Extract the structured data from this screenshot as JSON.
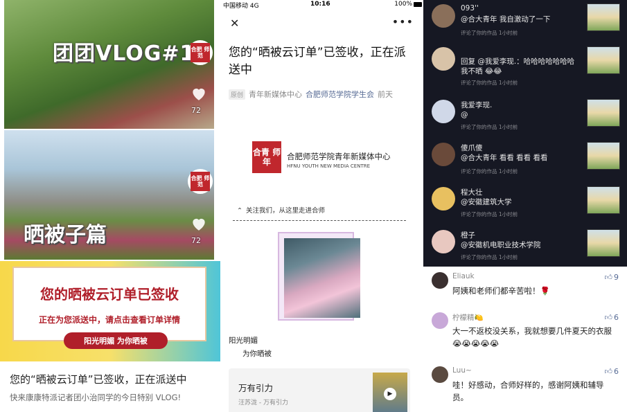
{
  "left_feed": {
    "videos": [
      {
        "title": "团团VLOG#1",
        "logo": "合肥 师范",
        "likes": "72"
      },
      {
        "title": "晒被子篇",
        "logo": "合肥 师范",
        "likes": "72"
      }
    ],
    "banner": {
      "headline": "您的晒被云订单已签收",
      "subline": "正在为您派送中，请点击查看订单详情",
      "pill": "阳光明媚 为你晒被"
    },
    "post_title": "您的“晒被云订单”已签收，正在派送中",
    "post_subtitle": "快来康康特派记者团小治同学的今日特别 VLOG!"
  },
  "article": {
    "status": {
      "carrier": "中国移动 4G",
      "time": "10:16",
      "battery": "100%"
    },
    "title": "您的“晒被云订单”已签收，正在派送中",
    "meta": {
      "badge": "原创",
      "author": "青年新媒体中心",
      "account": "合肥师范学院学生会",
      "date": "前天"
    },
    "publisher": {
      "logo": "合青 师年",
      "name": "合肥师范学院青年新媒体中心",
      "name_en": "HFNU YOUTH NEW MEDIA CENTRE"
    },
    "follow_text": "关注我们，从这里走进合师",
    "caption_line1": "阳光明媚",
    "caption_line2": "为你晒被",
    "music": {
      "title": "万有引力",
      "subtitle": "汪苏泷 - 万有引力"
    }
  },
  "dark_comments": [
    {
      "name": "093''",
      "text": "@合大青年 我自激动了一下",
      "meta": "评论了你的作品  1小时前",
      "avatar_color": "#8a6f5a"
    },
    {
      "name": "",
      "text": "回复 @我爱李现.：哈哈哈哈哈哈哈我不晒 😂😂",
      "meta": "评论了你的作品  1小时前",
      "avatar_color": "#d8c3a8"
    },
    {
      "name": "我爱李现.",
      "text": "@",
      "meta": "评论了你的作品  1小时前",
      "avatar_color": "#d0d8e8"
    },
    {
      "name": "傻爪傻",
      "text": "@合大青年 看看 看看 看看",
      "meta": "评论了你的作品  1小时前",
      "avatar_color": "#6a4a3a"
    },
    {
      "name": "程大壮",
      "text": "@安徽建筑大学",
      "meta": "评论了你的作品  1小时前",
      "avatar_color": "#e8c060"
    },
    {
      "name": "橙子",
      "text": "@安徽机电职业技术学院",
      "meta": "评论了你的作品  1小时前",
      "avatar_color": "#e8c8c0"
    }
  ],
  "light_comments": [
    {
      "name": "Eliauk",
      "text": "阿姨和老师们都辛苦啦！🌹",
      "likes": "9",
      "avatar_color": "#3a3030"
    },
    {
      "name": "柠檬精🍋",
      "text": "大一不返校没关系，我就想要几件夏天的衣服 😭😭😭😭😭",
      "likes": "6",
      "avatar_color": "#c8a8d8"
    },
    {
      "name": "Luu~",
      "text": "哇！好感动，合师好样的，感谢阿姨和辅导员。",
      "likes": "6",
      "avatar_color": "#5a4a40"
    }
  ]
}
